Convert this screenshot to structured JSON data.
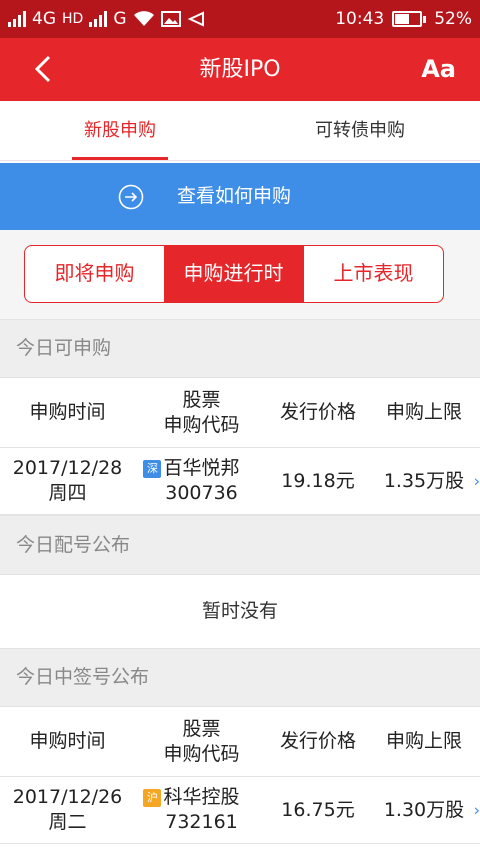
{
  "status_bar": {
    "network_1": "4G",
    "network_hd": "HD",
    "network_2": "G",
    "time": "10:43",
    "battery": "52%",
    "battery_level": 0.52
  },
  "header": {
    "title": "新股IPO",
    "font_size_label": "Aa"
  },
  "top_tabs": [
    {
      "label": "新股申购",
      "active": true
    },
    {
      "label": "可转债申购",
      "active": false
    }
  ],
  "banner": {
    "label": "查看如何申购"
  },
  "segments": [
    {
      "label": "即将申购",
      "active": false
    },
    {
      "label": "申购进行时",
      "active": true
    },
    {
      "label": "上市表现",
      "active": false
    }
  ],
  "sections": {
    "today_subscribe": {
      "title": "今日可申购",
      "columns": [
        "申购时间",
        "股票",
        "申购代码",
        "发行价格",
        "申购上限"
      ],
      "rows": [
        {
          "date": "2017/12/28",
          "weekday": "周四",
          "market": "深",
          "name": "百华悦邦",
          "code": "300736",
          "price": "19.18元",
          "limit": "1.35万股"
        }
      ]
    },
    "today_allot": {
      "title": "今日配号公布",
      "empty_text": "暂时没有"
    },
    "today_lottery": {
      "title": "今日中签号公布",
      "columns": [
        "申购时间",
        "股票",
        "申购代码",
        "发行价格",
        "申购上限"
      ],
      "rows": [
        {
          "date": "2017/12/26",
          "weekday": "周二",
          "market": "沪",
          "name": "科华控股",
          "code": "732161",
          "price": "16.75元",
          "limit": "1.30万股"
        }
      ]
    }
  },
  "colors": {
    "status_bar": "#b5161c",
    "header": "#e5262a",
    "banner": "#3e8ee8",
    "badge_sz": "#3e8ee8",
    "badge_sh": "#f5a623"
  }
}
